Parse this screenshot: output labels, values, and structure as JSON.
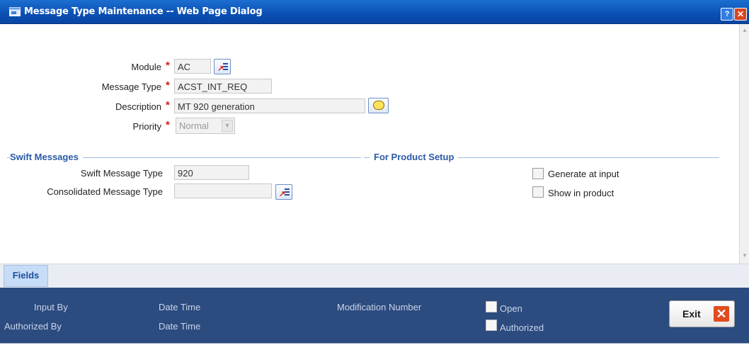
{
  "window": {
    "title": "Message Type Maintenance -- Web Page Dialog",
    "help_label": "?",
    "close_label": "✕"
  },
  "form": {
    "module": {
      "label": "Module",
      "required_mark": "*",
      "value": "AC"
    },
    "message_type": {
      "label": "Message Type",
      "required_mark": "*",
      "value": "ACST_INT_REQ"
    },
    "description": {
      "label": "Description",
      "required_mark": "*",
      "value": "MT 920 generation"
    },
    "priority": {
      "label": "Priority",
      "required_mark": "*",
      "value": "Normal"
    }
  },
  "swift_messages": {
    "title": "Swift Messages",
    "swift_message_type": {
      "label": "Swift Message Type",
      "value": "920"
    },
    "consolidated_message_type": {
      "label": "Consolidated Message Type",
      "value": ""
    }
  },
  "product_setup": {
    "title": "For Product Setup",
    "generate_at_input": {
      "label": "Generate at input",
      "checked": false
    },
    "show_in_product": {
      "label": "Show in product",
      "checked": false
    }
  },
  "tabs": [
    {
      "label": "Fields",
      "active": true
    }
  ],
  "footer": {
    "input_by": "Input By",
    "date_time_1": "Date Time",
    "authorized_by": "Authorized By",
    "date_time_2": "Date Time",
    "modification_number": "Modification Number",
    "open": {
      "label": "Open",
      "checked": false
    },
    "authorized": {
      "label": "Authorized",
      "checked": false
    },
    "exit_label": "Exit"
  },
  "colors": {
    "title_bar": "#0b4fb4",
    "required_mark": "#d81b1b",
    "section_title": "#2a5aa8",
    "footer_bg": "#2c4b7f",
    "exit_icon": "#e24b1e"
  },
  "icons": [
    "window-icon",
    "help-icon",
    "close-icon",
    "lov-icon",
    "speech-bubble-icon",
    "dropdown-arrow-icon",
    "exit-icon",
    "scroll-up-icon",
    "scroll-down-icon"
  ]
}
